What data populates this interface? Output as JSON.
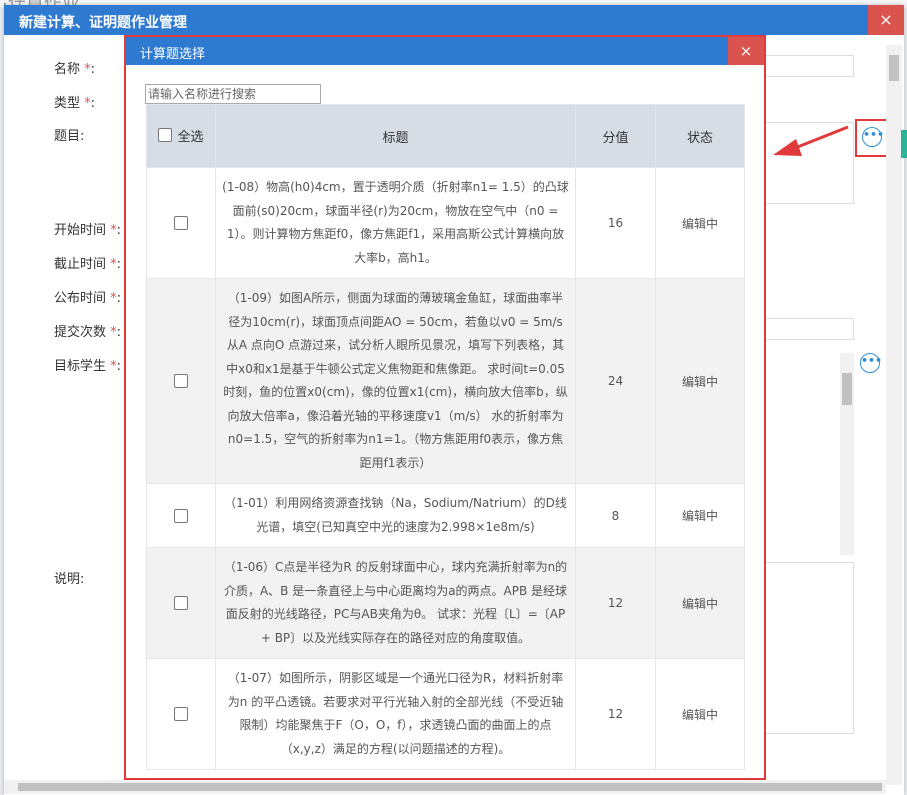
{
  "background": {
    "header_text": "·计算作业"
  },
  "outer": {
    "title": "新建计算、证明题作业管理",
    "close": "×",
    "labels": {
      "name": "名称",
      "type": "类型",
      "question": "题目:",
      "start": "开始时间",
      "deadline": "截止时间",
      "publish": "公布时间",
      "submit_count": "提交次数",
      "target": "目标学生",
      "desc": "说明:"
    },
    "required_mark": "*",
    "colon": ":"
  },
  "dialog": {
    "title": "计算题选择",
    "close": "×",
    "search_placeholder": "请输入名称进行搜索",
    "headers": {
      "select_all": "全选",
      "title": "标题",
      "score": "分值",
      "status": "状态"
    },
    "rows": [
      {
        "title": "(1-08）物高(h0)4cm，置于透明介质（折射率n1= 1.5）的凸球面前(s0)20cm，球面半径(r)为20cm，物放在空气中（n0 = 1）。则计算物方焦距f0，像方焦距f1，采用高斯公式计算横向放大率b，高h1。",
        "score": "16",
        "status": "编辑中"
      },
      {
        "title": "（1-09）如图A所示，侧面为球面的薄玻璃金鱼缸，球面曲率半径为10cm(r)，球面顶点间距AO = 50cm，若鱼以v0 = 5m/s 从A 点向O 点游过来，试分析人眼所见景况，填写下列表格，其中x0和x1是基于牛顿公式定义焦物距和焦像距。 求时间t=0.05时刻，鱼的位置x0(cm)，像的位置x1(cm)，横向放大倍率b，纵向放大倍率a，像沿着光轴的平移速度v1（m/s） 水的折射率为n0=1.5，空气的折射率为n1=1。（物方焦距用f0表示，像方焦距用f1表示）",
        "score": "24",
        "status": "编辑中"
      },
      {
        "title": "（1-01）利用网络资源查找钠（Na，Sodium/Natrium）的D线光谱，填空(已知真空中光的速度为2.998×1e8m/s)",
        "score": "8",
        "status": "编辑中"
      },
      {
        "title": "（1-06）C点是半径为R 的反射球面中心，球内充满折射率为n的介质，A、B 是一条直径上与中心距离均为a的两点。APB 是经球面反射的光线路径，PC与AB夹角为θ。 试求：光程〔L〕=〔AP + BP〕以及光线实际存在的路径对应的角度取值。",
        "score": "12",
        "status": "编辑中"
      },
      {
        "title": "（1-07）如图所示，阴影区域是一个通光口径为R，材料折射率为n 的平凸透镜。若要求对平行光轴入射的全部光线（不受近轴限制）均能聚焦于F（O，O，f），求透镜凸面的曲面上的点（x,y,z）满足的方程(以问题描述的方程)。",
        "score": "12",
        "status": "编辑中"
      }
    ]
  },
  "colors": {
    "titlebar": "#2f7ad1",
    "close": "#d9534f",
    "highlight": "#e03a3a",
    "header_bg": "#d7dde5"
  }
}
